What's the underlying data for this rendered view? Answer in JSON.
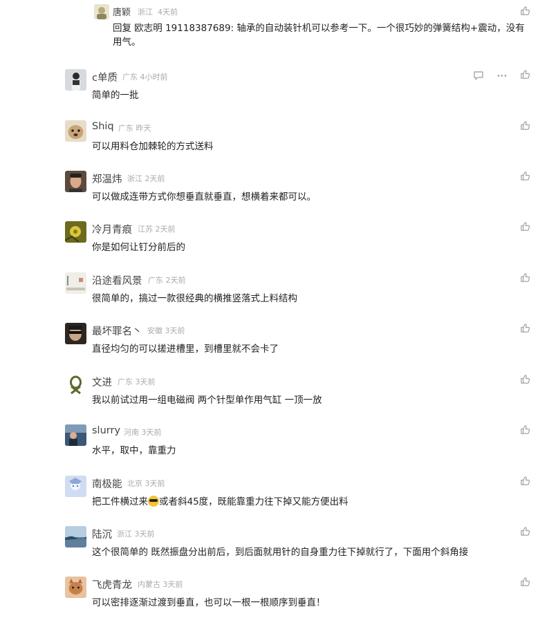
{
  "reply": {
    "name": "唐颖",
    "region": "浙江",
    "time": "4天前",
    "prefix": "回复",
    "mention": "欧志明 19118387689",
    "text": ": 轴承的自动装针机可以参考一下。一个很巧妙的弹簧结构+震动，没有用气。"
  },
  "comments": [
    {
      "name": "c单质",
      "region": "广东",
      "time": "4小时前",
      "text": "简单的一批",
      "avatar_color": "#cfd3d8",
      "avatar_icon": "person-photo"
    },
    {
      "name": "Shiq",
      "region": "广东",
      "time": "昨天",
      "text": "可以用料仓加棘轮的方式送料",
      "avatar_color": "#c9a477",
      "avatar_icon": "dog-photo"
    },
    {
      "name": "郑温炜",
      "region": "浙江",
      "time": "2天前",
      "text": "可以做成连带方式你想垂直就垂直，想横着来都可以。",
      "avatar_color": "#7b5a4a",
      "avatar_icon": "portrait-photo"
    },
    {
      "name": "冷月青痕",
      "region": "江苏",
      "time": "2天前",
      "text": "你是如何让钉分前后的",
      "avatar_color": "#a39b3a",
      "avatar_icon": "flower-photo"
    },
    {
      "name": "沿途看风景",
      "region": "广东",
      "time": "2天前",
      "text": "很简单的，搞过一款很经典的横推竖落式上料结构",
      "avatar_color": "#e6e2dc",
      "avatar_icon": "landscape-photo"
    },
    {
      "name": "最坏罪名丶",
      "region": "安徽",
      "time": "3天前",
      "text": "直径均匀的可以搓进槽里，到槽里就不会卡了",
      "avatar_color": "#4a3a30",
      "avatar_icon": "face-photo"
    },
    {
      "name": "文进",
      "region": "广东",
      "time": "3天前",
      "text": "我以前试过用一组电磁阀 两个针型单作用气缸 一顶一放",
      "avatar_color": "#e8e8d8",
      "avatar_icon": "knot-logo"
    },
    {
      "name": "slurry",
      "region": "河南",
      "time": "3天前",
      "text": "水平，取中，靠重力",
      "avatar_color": "#4d6b8a",
      "avatar_icon": "person-photo"
    },
    {
      "name": "南极能",
      "region": "北京",
      "time": "3天前",
      "text_before": "把工件横过来",
      "emoji": "cool-emoji",
      "text_after": "或者斜45度，既能靠重力往下掉又能方便出料",
      "avatar_color": "#b8c8e8",
      "avatar_icon": "anime-photo"
    },
    {
      "name": "陆沉",
      "region": "浙江",
      "time": "3天前",
      "text": "这个很简单的  既然振盘分出前后，到后面就用针的自身重力往下掉就行了，下面用个斜角接",
      "avatar_color": "#8aa6c0",
      "avatar_icon": "sea-photo"
    },
    {
      "name": "飞虎青龙",
      "region": "内蒙古",
      "time": "3天前",
      "text": "可以密排逐渐过渡到垂直，也可以一根一根顺序到垂直！",
      "avatar_color": "#c48a5a",
      "avatar_icon": "cat-photo"
    }
  ],
  "icons": {
    "like": "thumbs-up-icon",
    "reply": "reply-bubble-icon",
    "more": "more-dots-icon"
  }
}
